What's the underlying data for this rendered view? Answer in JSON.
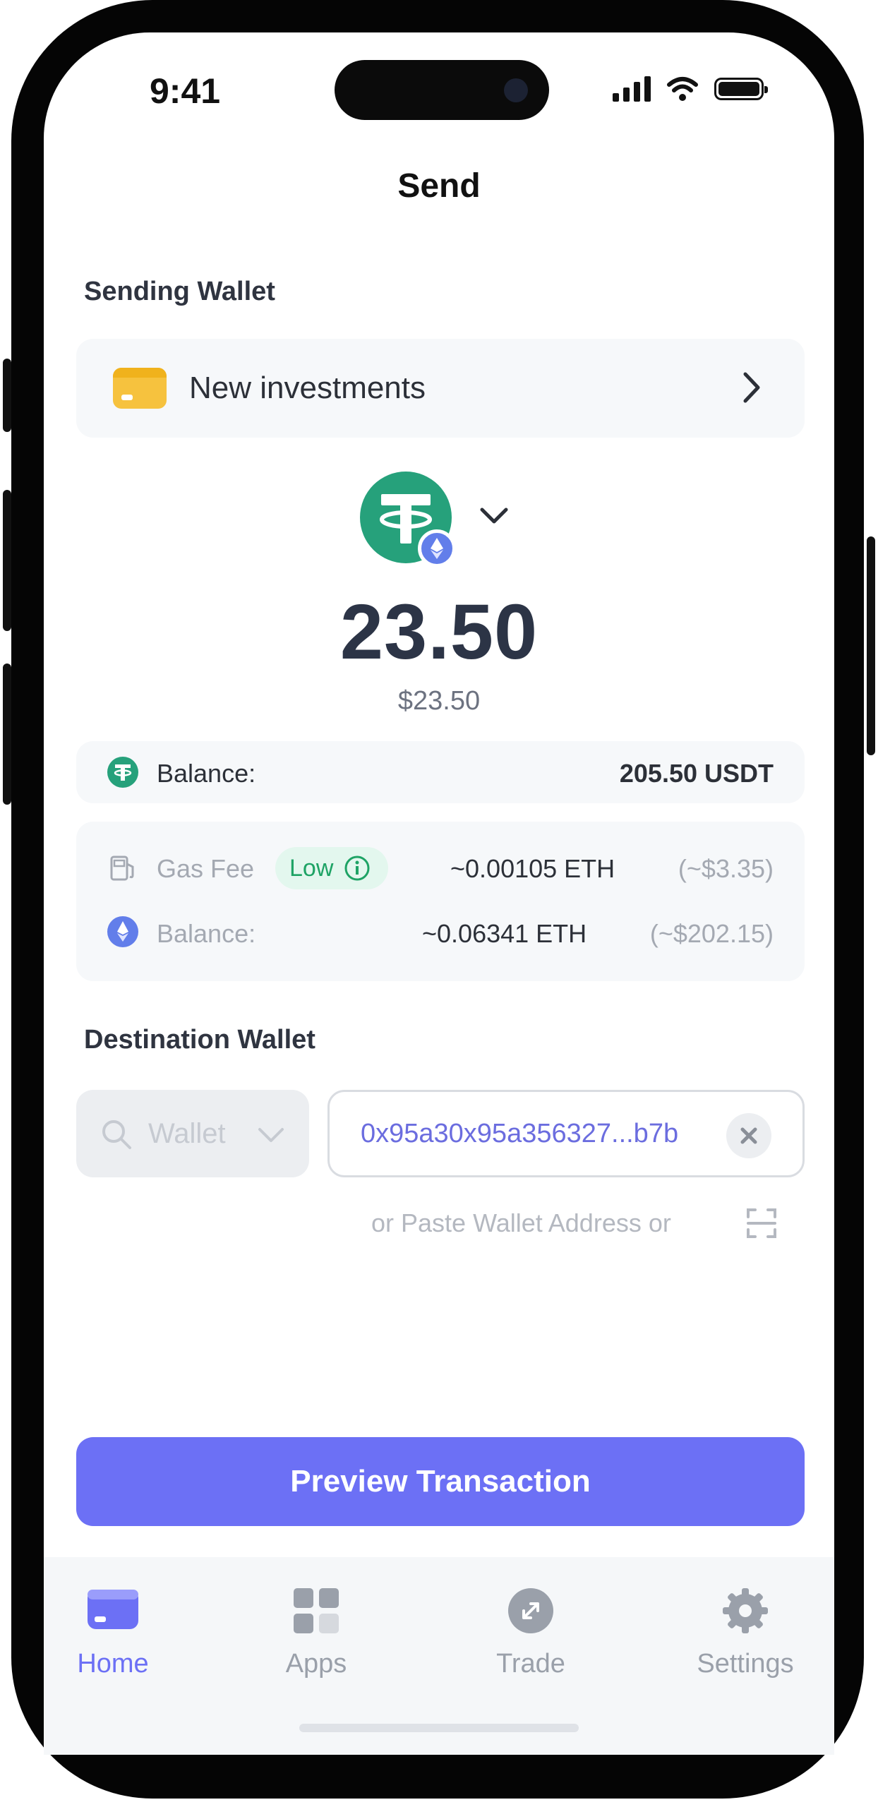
{
  "status_bar": {
    "time": "9:41"
  },
  "header": {
    "title": "Send"
  },
  "sending": {
    "label": "Sending Wallet",
    "wallet_name": "New investments",
    "wallet_color": "#F6C23E"
  },
  "token": {
    "icon": "tether-icon",
    "network_icon": "ethereum-icon",
    "amount": "23.50",
    "amount_fiat": "$23.50"
  },
  "token_balance": {
    "label": "Balance:",
    "value": "205.50 USDT"
  },
  "gas": {
    "label": "Gas Fee",
    "level": "Low",
    "fee_eth": "~0.00105 ETH",
    "fee_usd": "(~$3.35)",
    "balance_label": "Balance:",
    "balance_eth": "~0.06341 ETH",
    "balance_usd": "(~$202.15)"
  },
  "destination": {
    "label": "Destination Wallet",
    "wallet_placeholder": "Wallet",
    "address": "0x95a30x95a356327...b7b",
    "paste_hint": "or Paste Wallet Address or"
  },
  "actions": {
    "preview": "Preview Transaction"
  },
  "tabs": [
    {
      "label": "Home",
      "icon": "wallet-icon",
      "active": true
    },
    {
      "label": "Apps",
      "icon": "apps-grid-icon",
      "active": false
    },
    {
      "label": "Trade",
      "icon": "swap-icon",
      "active": false
    },
    {
      "label": "Settings",
      "icon": "gear-icon",
      "active": false
    }
  ],
  "colors": {
    "accent": "#6C70F5",
    "tether": "#26A17B",
    "ethereum": "#627EEA",
    "low": "#1EA365"
  }
}
